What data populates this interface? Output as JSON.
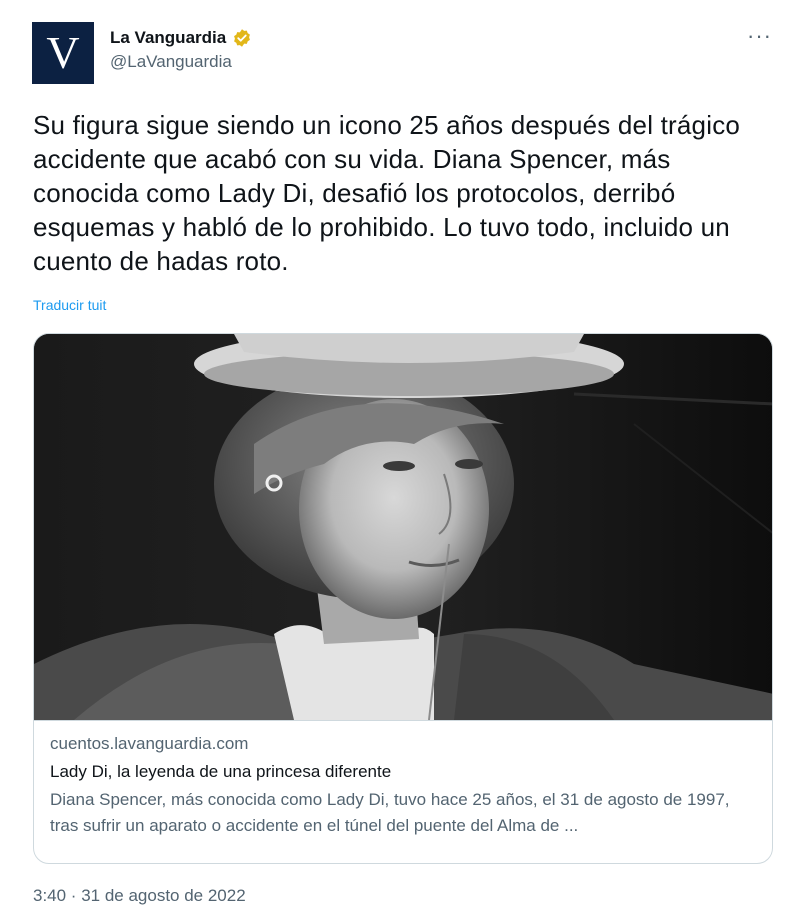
{
  "account": {
    "avatar_letter": "V",
    "display_name": "La Vanguardia",
    "handle": "@LaVanguardia",
    "verified_color": "#e2b719"
  },
  "more_label": "···",
  "tweet": {
    "text": "Su figura sigue siendo un icono 25 años después del trágico accidente que acabó con su vida. Diana Spencer, más conocida como Lady Di, desafió los protocolos, derribó esquemas y habló de lo prohibido. Lo tuvo todo, incluido un cuento de hadas roto.",
    "translate_label": "Traducir tuit",
    "timestamp": "3:40 · 31 de agosto de 2022"
  },
  "card": {
    "image_icon": "photo-portrait",
    "domain": "cuentos.lavanguardia.com",
    "title": "Lady Di, la leyenda de una princesa diferente",
    "description": "Diana Spencer, más conocida como Lady Di, tuvo hace 25 años, el 31 de agosto de 1997, tras sufrir un aparato o accidente en el túnel del puente del Alma de ..."
  },
  "colors": {
    "link": "#1d9bf0",
    "secondary_text": "#536471",
    "avatar_bg": "#0c2142"
  }
}
